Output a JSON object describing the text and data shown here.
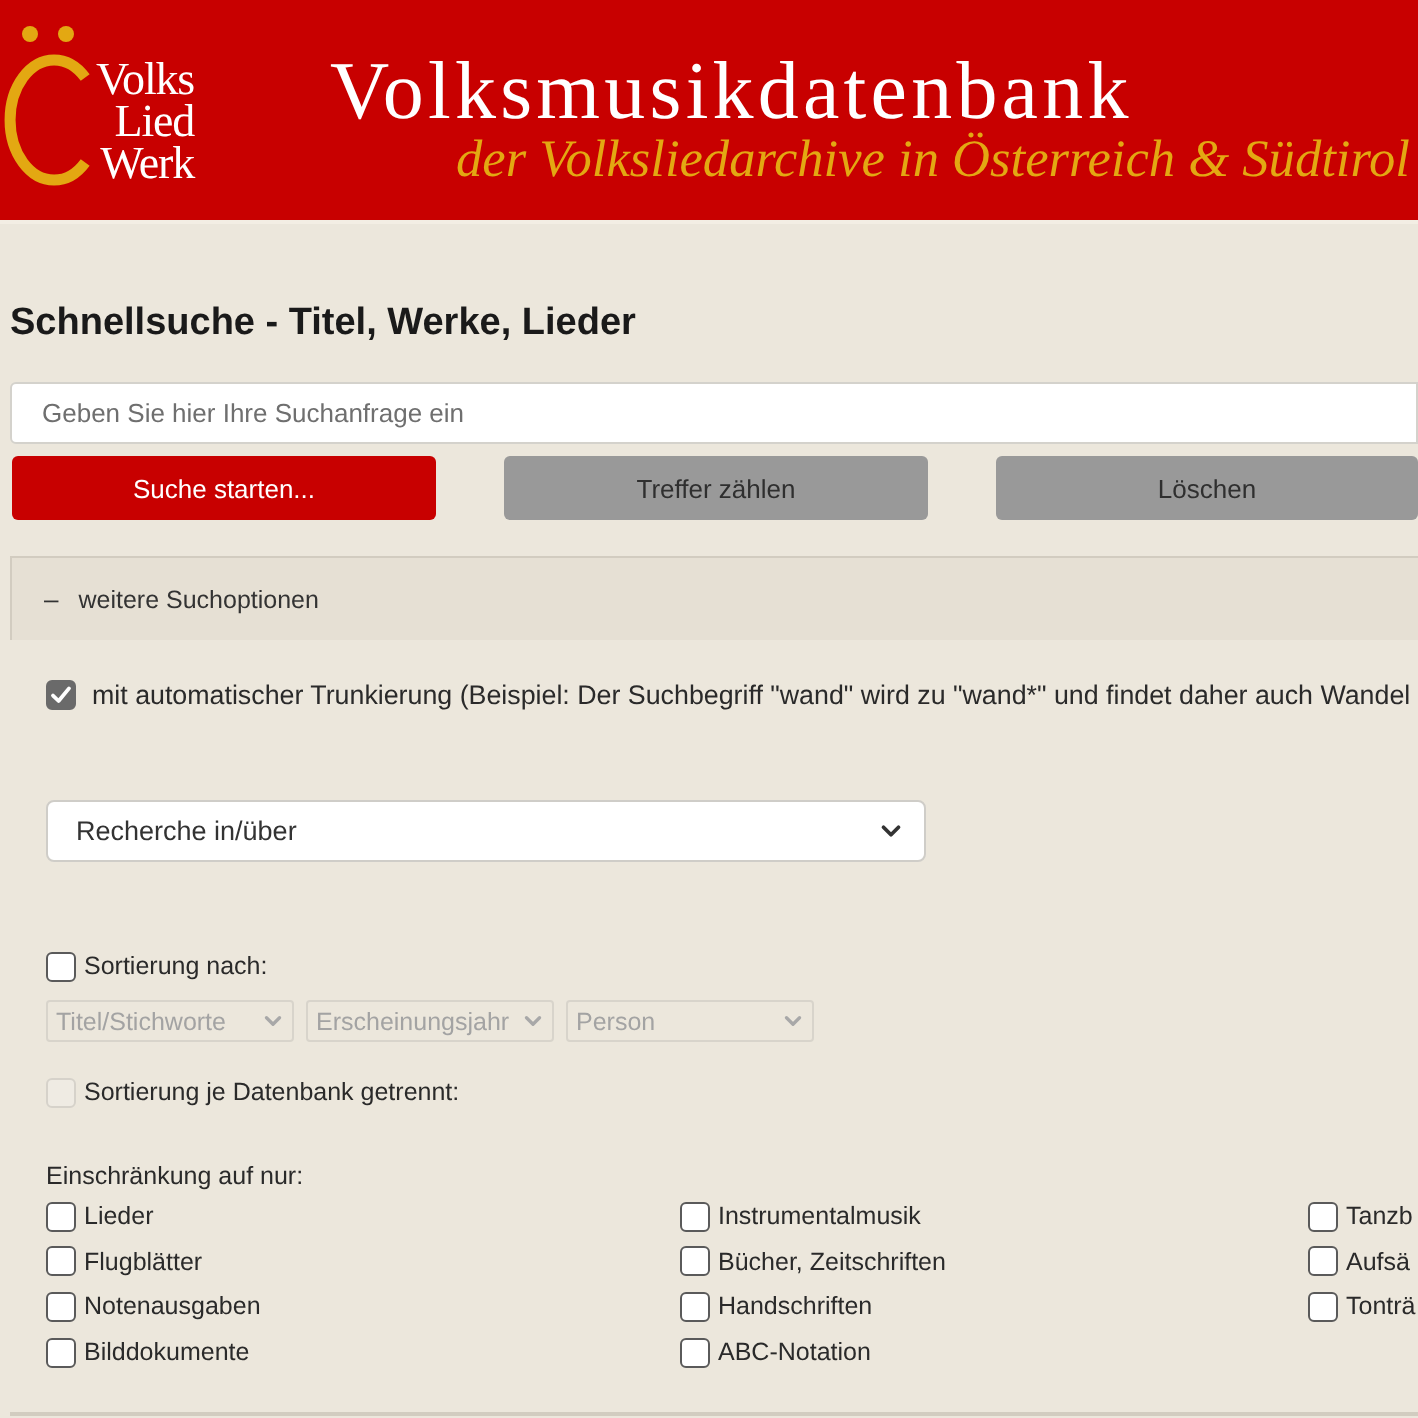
{
  "header": {
    "logo_lines": [
      "Volks",
      "Lied",
      "Werk"
    ],
    "title": "Volksmusikdatenbank",
    "subtitle": "der Volksliedarchive in Österreich & Südtirol"
  },
  "heading": "Schnellsuche - Titel, Werke, Lieder",
  "search": {
    "placeholder": "Geben Sie hier Ihre Suchanfrage ein"
  },
  "buttons": [
    {
      "label": "Suche starten...",
      "kind": "primary"
    },
    {
      "label": "Treffer zählen",
      "kind": "secondary"
    },
    {
      "label": "Löschen",
      "kind": "secondary"
    }
  ],
  "options": {
    "toggle": "–",
    "label": "weitere Suchoptionen",
    "truncation": {
      "label": "mit automatischer Trunkierung (Beispiel: Der Suchbegriff \"wand\" wird zu \"wand*\" und findet daher auch Wandel",
      "checked": true
    },
    "research_select": {
      "value": "Recherche in/über"
    },
    "sort": {
      "label": "Sortierung nach:",
      "checked": false,
      "selects": [
        {
          "value": "Titel/Stichworte",
          "disabled": true
        },
        {
          "value": "Erscheinungsjahr",
          "disabled": true
        },
        {
          "value": "Person",
          "disabled": true
        }
      ]
    },
    "sort_separate": {
      "label": "Sortierung je Datenbank getrennt:",
      "checked": false,
      "disabled": true
    },
    "restriction": {
      "label": "Einschränkung auf nur:",
      "columns": [
        {
          "items": [
            {
              "label": "Lieder",
              "checked": false
            },
            {
              "label": "Flugblätter",
              "checked": false
            },
            {
              "label": "Notenausgaben",
              "checked": false
            },
            {
              "label": "Bilddokumente",
              "checked": false
            }
          ]
        },
        {
          "items": [
            {
              "label": "Instrumentalmusik",
              "checked": false
            },
            {
              "label": "Bücher, Zeitschriften",
              "checked": false
            },
            {
              "label": "Handschriften",
              "checked": false
            },
            {
              "label": "ABC-Notation",
              "checked": false
            }
          ]
        },
        {
          "items": [
            {
              "label": "Tanzb",
              "checked": false
            },
            {
              "label": "Aufsä",
              "checked": false
            },
            {
              "label": "Tonträ",
              "checked": false
            }
          ]
        }
      ]
    }
  }
}
